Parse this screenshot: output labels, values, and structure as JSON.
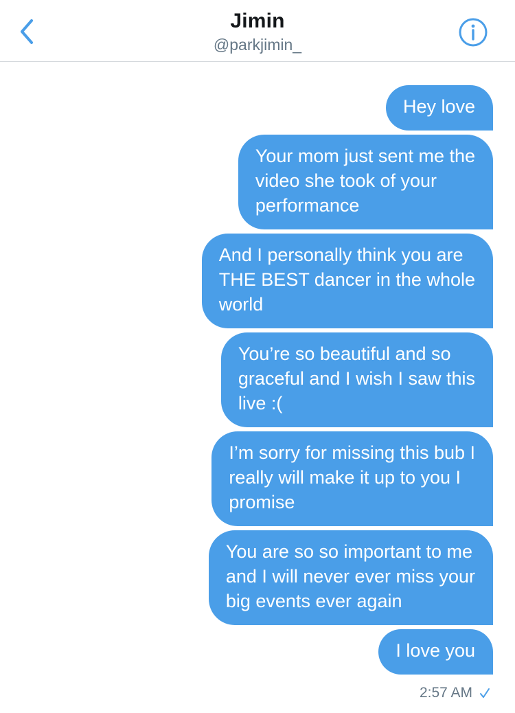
{
  "header": {
    "title": "Jimin",
    "handle": "@parkjimin_",
    "back_icon": "chevron-left-icon",
    "info_icon": "info-circle-icon"
  },
  "colors": {
    "accent": "#4a9ee8",
    "bubble_text": "#ffffff",
    "meta_text": "#657786"
  },
  "messages": [
    {
      "text": "Hey love"
    },
    {
      "text": "Your mom just sent me the\nvideo she took of your\nperformance"
    },
    {
      "text": "And I personally think you are\nTHE BEST dancer in the whole\nworld"
    },
    {
      "text": "You’re so beautiful and so\ngraceful and I wish I saw this\nlive :("
    },
    {
      "text": "I’m sorry for missing this bub I\nreally will make it up to you I\npromise"
    },
    {
      "text": "You are so so important to me\nand I will never ever miss your\nbig events ever again"
    },
    {
      "text": "I love you"
    }
  ],
  "status": {
    "time": "2:57 AM",
    "read_icon": "checkmark-icon"
  }
}
